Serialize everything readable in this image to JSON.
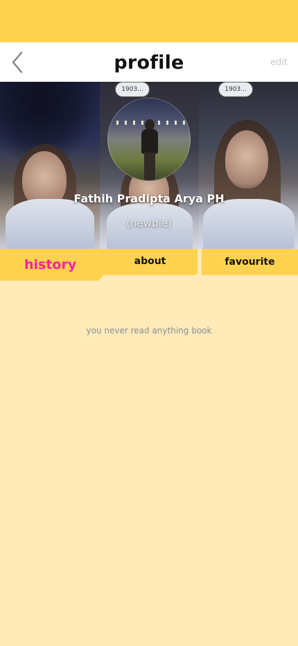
{
  "header": {
    "title": "profile",
    "edit_label": "edit",
    "back_icon": "chevron-left-icon"
  },
  "banner": {
    "sign_text": "1903...",
    "user_name": "Fathih Pradipta Arya PH",
    "user_rank": "(newbie)"
  },
  "tabs": [
    {
      "label": "history",
      "active": true
    },
    {
      "label": "about",
      "active": false
    },
    {
      "label": "favourite",
      "active": false
    }
  ],
  "history": {
    "empty_message": "you never read anything book"
  },
  "colors": {
    "accent_yellow": "#ffd24f",
    "page_background": "#ffeab8",
    "active_tab_text": "#ff1fa8"
  }
}
